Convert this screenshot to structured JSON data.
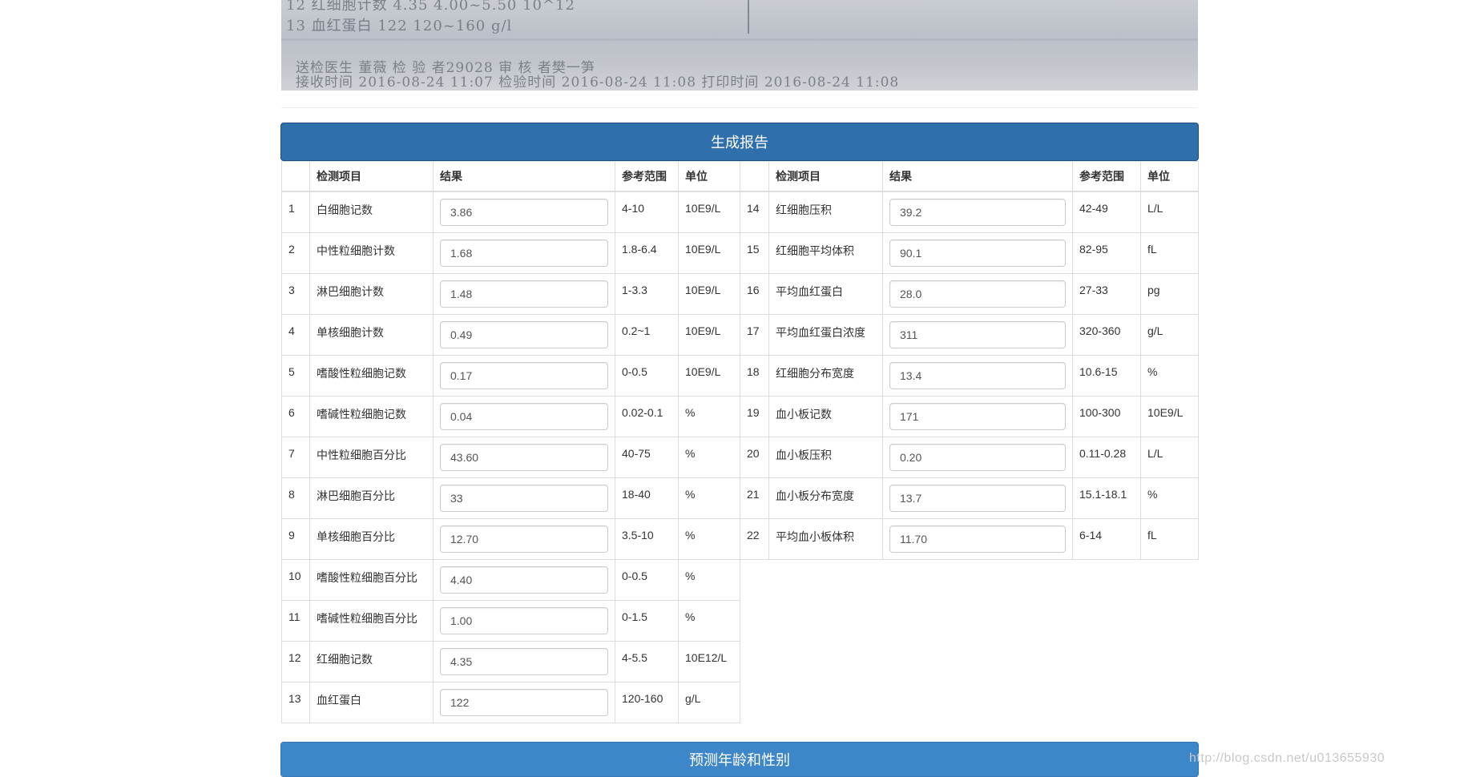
{
  "scan_image": {
    "lines": [
      "12 红细胞计数          4.35          4.00~5.50      10^12",
      "13 血红蛋白            122           120~160        g/l",
      "送检医生 董薇                      检 验 者29028                      审 核 者樊一笋",
      "接收时间 2016-08-24 11:07          检验时间 2016-08-24 11:08          打印时间 2016-08-24 11:08"
    ]
  },
  "generate_button_label": "生成报告",
  "predict_button_label": "预测年龄和性别",
  "watermark": "http://blog.csdn.net/u013655930",
  "headers": {
    "index": "",
    "item": "检测项目",
    "result": "结果",
    "range": "参考范围",
    "unit": "单位"
  },
  "left_rows": [
    {
      "no": "1",
      "item": "白细胞记数",
      "value": "3.86",
      "range": "4-10",
      "unit": "10E9/L"
    },
    {
      "no": "2",
      "item": "中性粒细胞计数",
      "value": "1.68",
      "range": "1.8-6.4",
      "unit": "10E9/L"
    },
    {
      "no": "3",
      "item": "淋巴细胞计数",
      "value": "1.48",
      "range": "1-3.3",
      "unit": "10E9/L"
    },
    {
      "no": "4",
      "item": "单核细胞计数",
      "value": "0.49",
      "range": "0.2~1",
      "unit": "10E9/L"
    },
    {
      "no": "5",
      "item": "嗜酸性粒细胞记数",
      "value": "0.17",
      "range": "0-0.5",
      "unit": "10E9/L"
    },
    {
      "no": "6",
      "item": "嗜碱性粒细胞记数",
      "value": "0.04",
      "range": "0.02-0.1",
      "unit": "%"
    },
    {
      "no": "7",
      "item": "中性粒细胞百分比",
      "value": "43.60",
      "range": "40-75",
      "unit": "%"
    },
    {
      "no": "8",
      "item": "淋巴细胞百分比",
      "value": "33",
      "range": "18-40",
      "unit": "%"
    },
    {
      "no": "9",
      "item": "单核细胞百分比",
      "value": "12.70",
      "range": "3.5-10",
      "unit": "%"
    },
    {
      "no": "10",
      "item": "嗜酸性粒细胞百分比",
      "value": "4.40",
      "range": "0-0.5",
      "unit": "%"
    },
    {
      "no": "11",
      "item": "嗜碱性粒细胞百分比",
      "value": "1.00",
      "range": "0-1.5",
      "unit": "%"
    },
    {
      "no": "12",
      "item": "红细胞记数",
      "value": "4.35",
      "range": "4-5.5",
      "unit": "10E12/L"
    },
    {
      "no": "13",
      "item": "血红蛋白",
      "value": "122",
      "range": "120-160",
      "unit": "g/L"
    }
  ],
  "right_rows": [
    {
      "no": "14",
      "item": "红细胞压积",
      "value": "39.2",
      "range": "42-49",
      "unit": "L/L"
    },
    {
      "no": "15",
      "item": "红细胞平均体积",
      "value": "90.1",
      "range": "82-95",
      "unit": "fL"
    },
    {
      "no": "16",
      "item": "平均血红蛋白",
      "value": "28.0",
      "range": "27-33",
      "unit": "pg"
    },
    {
      "no": "17",
      "item": "平均血红蛋白浓度",
      "value": "311",
      "range": "320-360",
      "unit": "g/L"
    },
    {
      "no": "18",
      "item": "红细胞分布宽度",
      "value": "13.4",
      "range": "10.6-15",
      "unit": "%"
    },
    {
      "no": "19",
      "item": "血小板记数",
      "value": "171",
      "range": "100-300",
      "unit": "10E9/L"
    },
    {
      "no": "20",
      "item": "血小板压积",
      "value": "0.20",
      "range": "0.11-0.28",
      "unit": "L/L"
    },
    {
      "no": "21",
      "item": "血小板分布宽度",
      "value": "13.7",
      "range": "15.1-18.1",
      "unit": "%"
    },
    {
      "no": "22",
      "item": "平均血小板体积",
      "value": "11.70",
      "range": "6-14",
      "unit": "fL"
    }
  ],
  "colors": {
    "generate_button": "#2f6fac",
    "predict_button": "#3d87c9",
    "table_border": "#dddddd"
  }
}
